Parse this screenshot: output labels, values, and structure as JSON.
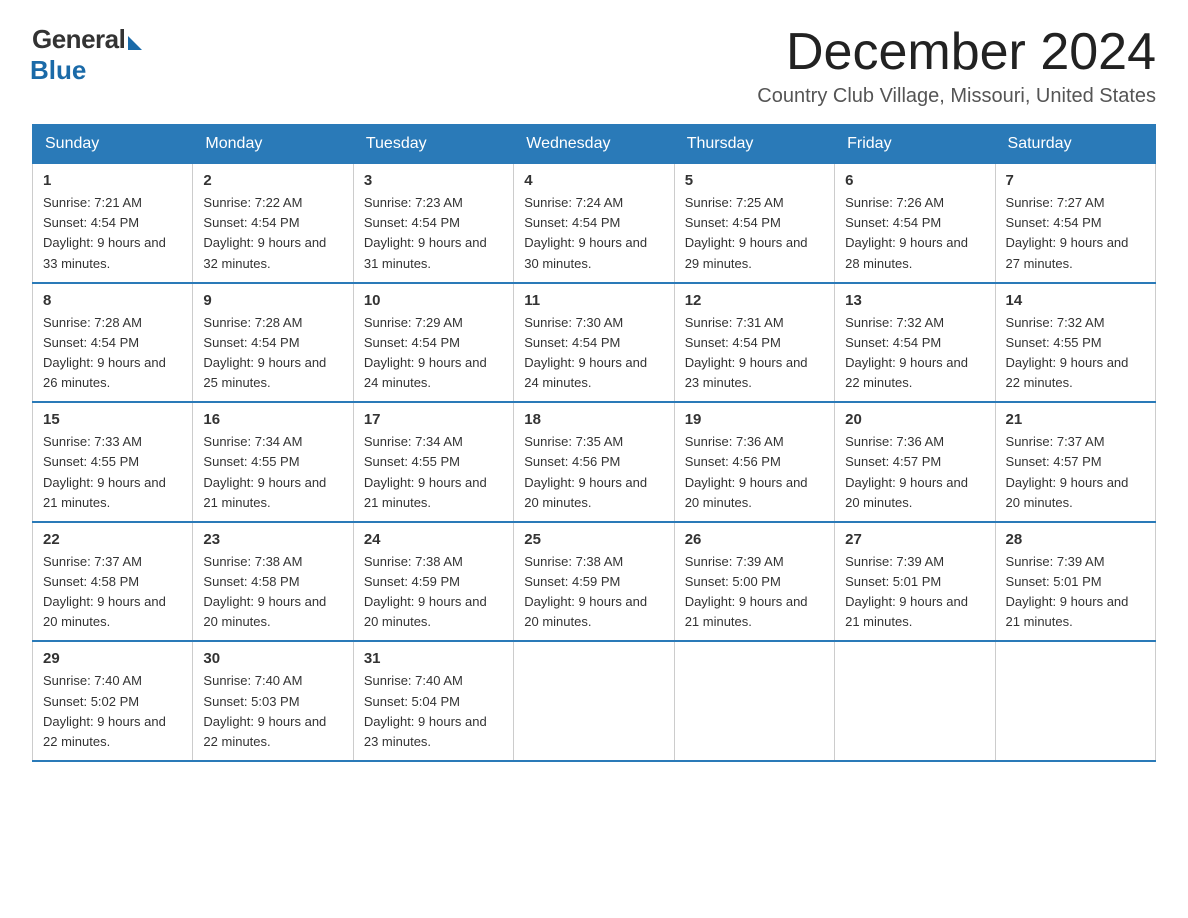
{
  "logo": {
    "general": "General",
    "blue": "Blue"
  },
  "title": "December 2024",
  "subtitle": "Country Club Village, Missouri, United States",
  "weekdays": [
    "Sunday",
    "Monday",
    "Tuesday",
    "Wednesday",
    "Thursday",
    "Friday",
    "Saturday"
  ],
  "weeks": [
    [
      {
        "day": "1",
        "sunrise": "7:21 AM",
        "sunset": "4:54 PM",
        "daylight": "9 hours and 33 minutes."
      },
      {
        "day": "2",
        "sunrise": "7:22 AM",
        "sunset": "4:54 PM",
        "daylight": "9 hours and 32 minutes."
      },
      {
        "day": "3",
        "sunrise": "7:23 AM",
        "sunset": "4:54 PM",
        "daylight": "9 hours and 31 minutes."
      },
      {
        "day": "4",
        "sunrise": "7:24 AM",
        "sunset": "4:54 PM",
        "daylight": "9 hours and 30 minutes."
      },
      {
        "day": "5",
        "sunrise": "7:25 AM",
        "sunset": "4:54 PM",
        "daylight": "9 hours and 29 minutes."
      },
      {
        "day": "6",
        "sunrise": "7:26 AM",
        "sunset": "4:54 PM",
        "daylight": "9 hours and 28 minutes."
      },
      {
        "day": "7",
        "sunrise": "7:27 AM",
        "sunset": "4:54 PM",
        "daylight": "9 hours and 27 minutes."
      }
    ],
    [
      {
        "day": "8",
        "sunrise": "7:28 AM",
        "sunset": "4:54 PM",
        "daylight": "9 hours and 26 minutes."
      },
      {
        "day": "9",
        "sunrise": "7:28 AM",
        "sunset": "4:54 PM",
        "daylight": "9 hours and 25 minutes."
      },
      {
        "day": "10",
        "sunrise": "7:29 AM",
        "sunset": "4:54 PM",
        "daylight": "9 hours and 24 minutes."
      },
      {
        "day": "11",
        "sunrise": "7:30 AM",
        "sunset": "4:54 PM",
        "daylight": "9 hours and 24 minutes."
      },
      {
        "day": "12",
        "sunrise": "7:31 AM",
        "sunset": "4:54 PM",
        "daylight": "9 hours and 23 minutes."
      },
      {
        "day": "13",
        "sunrise": "7:32 AM",
        "sunset": "4:54 PM",
        "daylight": "9 hours and 22 minutes."
      },
      {
        "day": "14",
        "sunrise": "7:32 AM",
        "sunset": "4:55 PM",
        "daylight": "9 hours and 22 minutes."
      }
    ],
    [
      {
        "day": "15",
        "sunrise": "7:33 AM",
        "sunset": "4:55 PM",
        "daylight": "9 hours and 21 minutes."
      },
      {
        "day": "16",
        "sunrise": "7:34 AM",
        "sunset": "4:55 PM",
        "daylight": "9 hours and 21 minutes."
      },
      {
        "day": "17",
        "sunrise": "7:34 AM",
        "sunset": "4:55 PM",
        "daylight": "9 hours and 21 minutes."
      },
      {
        "day": "18",
        "sunrise": "7:35 AM",
        "sunset": "4:56 PM",
        "daylight": "9 hours and 20 minutes."
      },
      {
        "day": "19",
        "sunrise": "7:36 AM",
        "sunset": "4:56 PM",
        "daylight": "9 hours and 20 minutes."
      },
      {
        "day": "20",
        "sunrise": "7:36 AM",
        "sunset": "4:57 PM",
        "daylight": "9 hours and 20 minutes."
      },
      {
        "day": "21",
        "sunrise": "7:37 AM",
        "sunset": "4:57 PM",
        "daylight": "9 hours and 20 minutes."
      }
    ],
    [
      {
        "day": "22",
        "sunrise": "7:37 AM",
        "sunset": "4:58 PM",
        "daylight": "9 hours and 20 minutes."
      },
      {
        "day": "23",
        "sunrise": "7:38 AM",
        "sunset": "4:58 PM",
        "daylight": "9 hours and 20 minutes."
      },
      {
        "day": "24",
        "sunrise": "7:38 AM",
        "sunset": "4:59 PM",
        "daylight": "9 hours and 20 minutes."
      },
      {
        "day": "25",
        "sunrise": "7:38 AM",
        "sunset": "4:59 PM",
        "daylight": "9 hours and 20 minutes."
      },
      {
        "day": "26",
        "sunrise": "7:39 AM",
        "sunset": "5:00 PM",
        "daylight": "9 hours and 21 minutes."
      },
      {
        "day": "27",
        "sunrise": "7:39 AM",
        "sunset": "5:01 PM",
        "daylight": "9 hours and 21 minutes."
      },
      {
        "day": "28",
        "sunrise": "7:39 AM",
        "sunset": "5:01 PM",
        "daylight": "9 hours and 21 minutes."
      }
    ],
    [
      {
        "day": "29",
        "sunrise": "7:40 AM",
        "sunset": "5:02 PM",
        "daylight": "9 hours and 22 minutes."
      },
      {
        "day": "30",
        "sunrise": "7:40 AM",
        "sunset": "5:03 PM",
        "daylight": "9 hours and 22 minutes."
      },
      {
        "day": "31",
        "sunrise": "7:40 AM",
        "sunset": "5:04 PM",
        "daylight": "9 hours and 23 minutes."
      },
      null,
      null,
      null,
      null
    ]
  ],
  "labels": {
    "sunrise": "Sunrise:",
    "sunset": "Sunset:",
    "daylight": "Daylight:"
  }
}
